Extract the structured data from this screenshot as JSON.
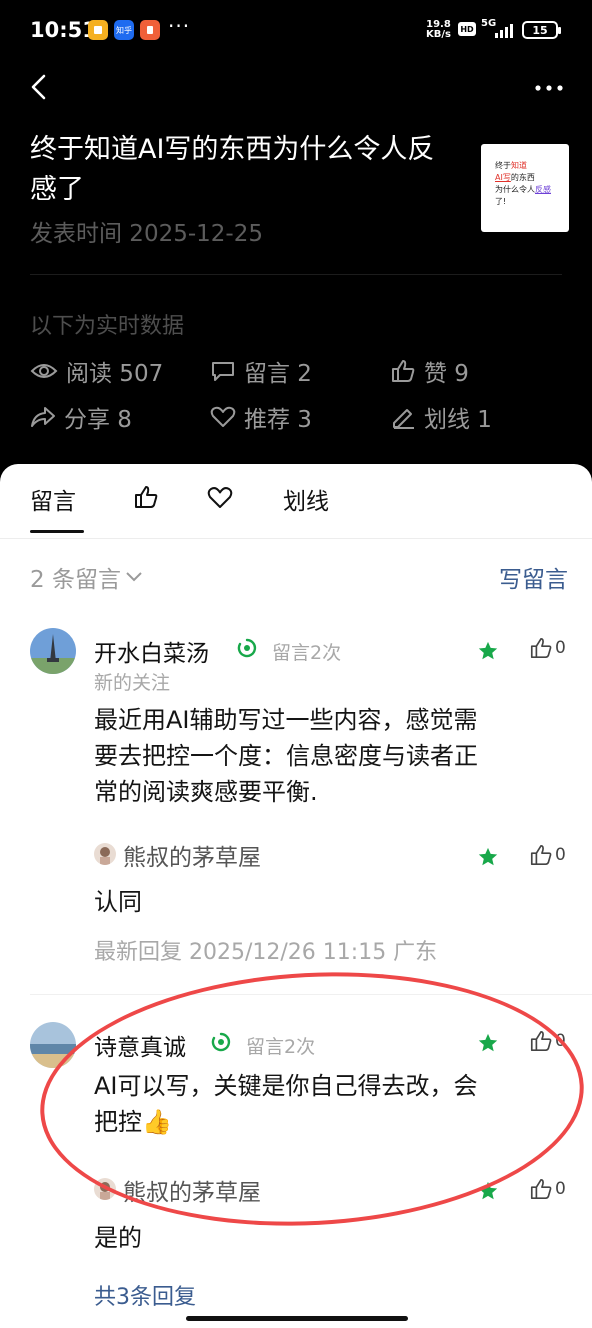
{
  "status_bar": {
    "time": "10:51",
    "app_icons": [
      {
        "name": "notes-app-icon",
        "label": "",
        "color": "#f5b020"
      },
      {
        "name": "zhihu-app-icon",
        "label": "知乎",
        "color": "#1e6bf0"
      },
      {
        "name": "red-app-icon",
        "label": "",
        "color": "#f0603a"
      }
    ],
    "more": "···",
    "speed_value": "19.8",
    "speed_unit": "KB/s",
    "hd": "HD",
    "network": "5G",
    "battery": "15"
  },
  "article": {
    "title": "终于知道AI写的东西为什么令人反感了",
    "pub_date": "发表时间 2025-12-25",
    "thumb": {
      "line1_a": "终于",
      "line1_b": "知道",
      "line2_a": "AI写",
      "line2_b": "的东西",
      "line3_a": "为什么令人",
      "line3_b": "反感",
      "line3_c": "了!"
    }
  },
  "realtime": {
    "label": "以下为实时数据",
    "reads": "阅读 507",
    "comments": "留言 2",
    "likes": "赞 9",
    "shares": "分享 8",
    "recommends": "推荐 3",
    "underlines": "划线 1"
  },
  "tabs": {
    "comments": "留言",
    "underline": "划线"
  },
  "comments_header": {
    "count": "2 条留言",
    "write": "写留言"
  },
  "comments": [
    {
      "name": "开水白菜汤",
      "count_label": "留言2次",
      "sub": "新的关注",
      "text_line1": "最近用AI辅助写过一些内容，感觉需",
      "text_line2": "要去把控一个度：信息密度与读者正",
      "text_line3": "常的阅读爽感要平衡.",
      "likes": "0",
      "reply": {
        "name": "熊叔的茅草屋",
        "text": "认同",
        "likes": "0"
      },
      "meta": "最新回复 2025/12/26 11:15  广东"
    },
    {
      "name": "诗意真诚",
      "count_label": "留言2次",
      "text_line1": "AI可以写，关键是你自己得去改，会",
      "text_line2": "把控👍",
      "likes": "0",
      "reply": {
        "name": "熊叔的茅草屋",
        "text": "是的",
        "likes": "0"
      },
      "more_replies": "共3条回复"
    }
  ],
  "colors": {
    "star": "#18a84a",
    "link": "#3b5c8f",
    "highlight_ring": "#ee4848"
  }
}
